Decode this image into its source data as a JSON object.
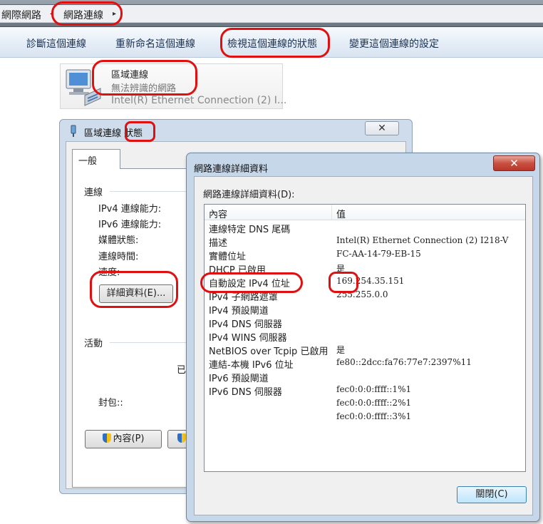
{
  "breadcrumb": {
    "items": [
      "網際網路",
      "網路連線"
    ],
    "separator_glyph": "◂",
    "expand_glyph": "▸"
  },
  "command_bar": {
    "items": [
      "診斷這個連線",
      "重新命名這個連線",
      "檢視這個連線的狀態",
      "變更這個連線的設定"
    ]
  },
  "connection_tile": {
    "name": "區域連線",
    "status": "無法辨識的網路",
    "device": "Intel(R) Ethernet Connection (2) I..."
  },
  "status_window": {
    "title_prefix": "區域連線",
    "title_suffix": "狀態",
    "close_glyph": "✕",
    "tab": "一般",
    "connection_section": "連線",
    "fields": [
      "IPv4 連線能力:",
      "IPv6 連線能力:",
      "媒體狀態:",
      "連線時間:",
      "速度:"
    ],
    "details_button": "詳細資料(E)...",
    "activity_section": "活動",
    "activity_partial": "已",
    "packets_label": "封包::",
    "properties_button": "內容(P)"
  },
  "details_window": {
    "title": "網路連線詳細資料",
    "close_glyph": "✕",
    "list_label": "網路連線詳細資料(D):",
    "col_property": "內容",
    "col_value": "值",
    "rows": [
      {
        "p": "連線特定 DNS 尾碼",
        "v": ""
      },
      {
        "p": "描述",
        "v": "Intel(R) Ethernet Connection (2) I218-V"
      },
      {
        "p": "實體位址",
        "v": "FC-AA-14-79-EB-15"
      },
      {
        "p": "DHCP 已啟用",
        "v": "是"
      },
      {
        "p": "自動設定 IPv4 位址",
        "v": "169.254.35.151"
      },
      {
        "p": "IPv4 子網路遮罩",
        "v": "255.255.0.0"
      },
      {
        "p": "IPv4 預設閘道",
        "v": ""
      },
      {
        "p": "IPv4 DNS 伺服器",
        "v": ""
      },
      {
        "p": "IPv4 WINS 伺服器",
        "v": ""
      },
      {
        "p": "NetBIOS over Tcpip 已啟用",
        "v": "是"
      },
      {
        "p": "連結-本機 IPv6 位址",
        "v": "fe80::2dcc:fa76:77e7:2397%11"
      },
      {
        "p": "IPv6 預設閘道",
        "v": ""
      },
      {
        "p": "IPv6 DNS 伺服器",
        "v": "fec0:0:0:ffff::1%1"
      },
      {
        "p": "",
        "v": "fec0:0:0:ffff::2%1"
      },
      {
        "p": "",
        "v": "fec0:0:0:ffff::3%1"
      }
    ],
    "close_button": "關閉(C)"
  },
  "annotation_color": "#e01010"
}
